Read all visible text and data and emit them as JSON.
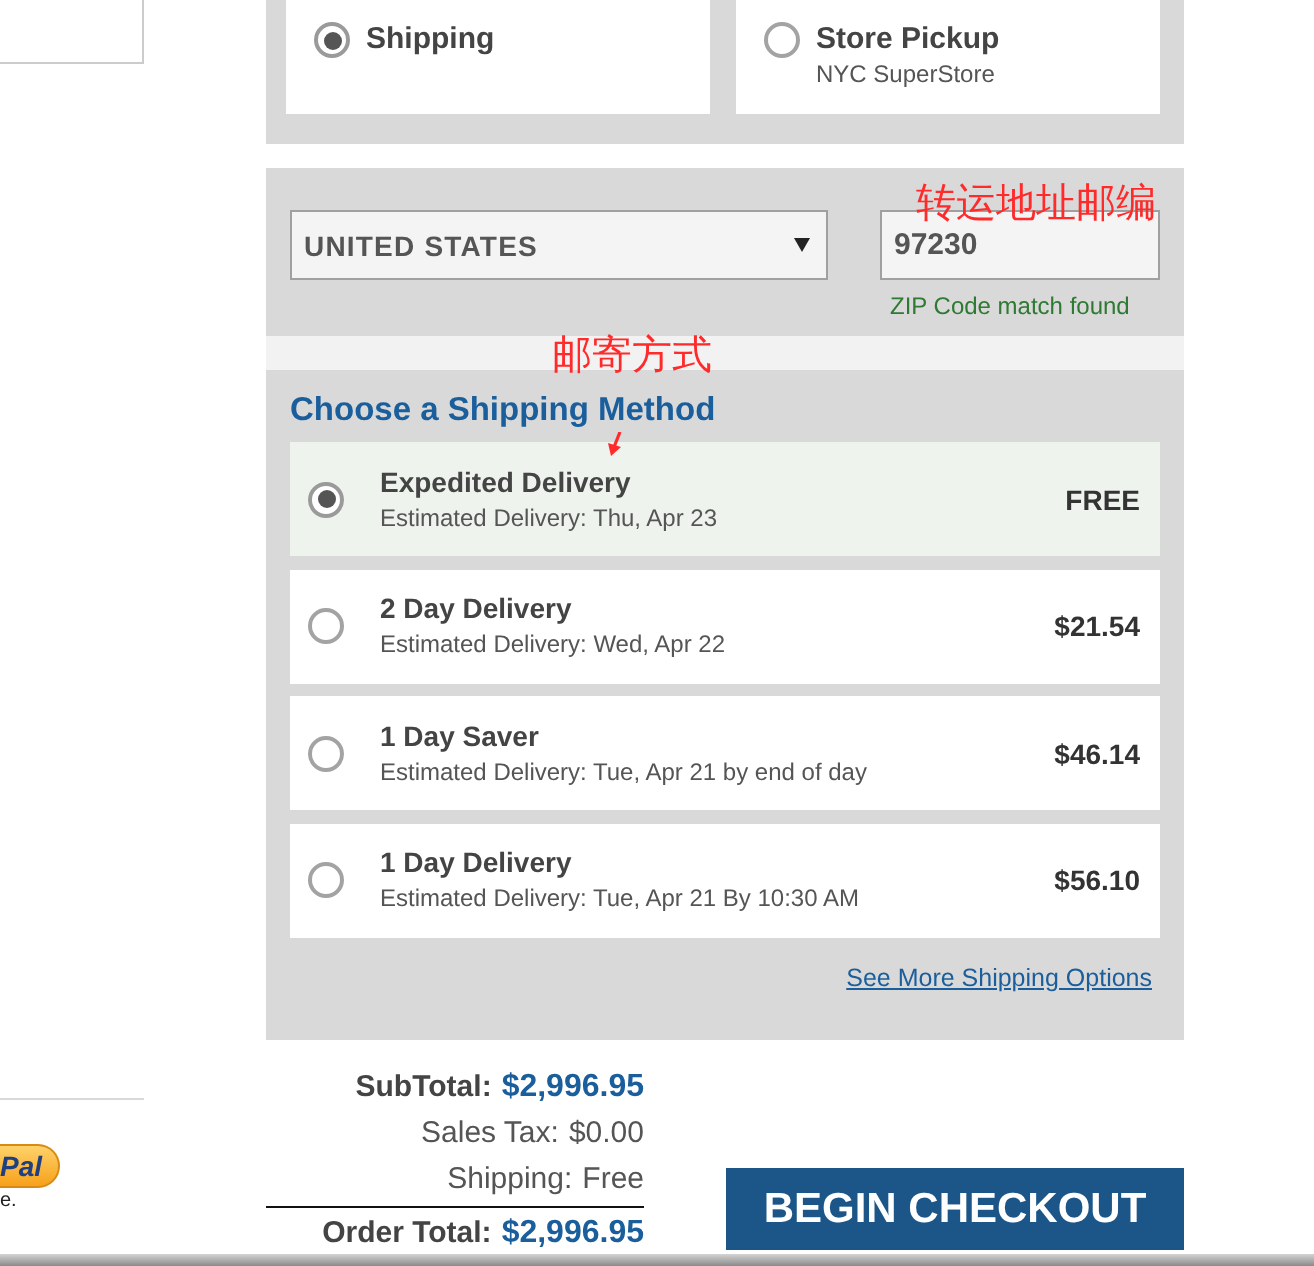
{
  "side": {
    "paypal_button": "Pal",
    "note": "e."
  },
  "delivery_options": [
    {
      "label": "Shipping",
      "selected": true
    },
    {
      "label": "Store Pickup",
      "sublabel": "NYC SuperStore",
      "selected": false
    }
  ],
  "address": {
    "country": "UNITED STATES",
    "zip": "97230",
    "zip_status": "ZIP Code match found"
  },
  "annotations": [
    {
      "kind": "text",
      "text": "转运地址邮编"
    },
    {
      "kind": "text",
      "text": "邮寄方式"
    },
    {
      "kind": "arrow"
    }
  ],
  "shipping": {
    "title": "Choose a Shipping Method",
    "methods": [
      {
        "name": "Expedited Delivery",
        "estimate": "Estimated Delivery: Thu, Apr 23",
        "price": "FREE",
        "selected": true
      },
      {
        "name": "2 Day Delivery",
        "estimate": "Estimated Delivery: Wed, Apr 22",
        "price": "$21.54",
        "selected": false
      },
      {
        "name": "1 Day Saver",
        "estimate": "Estimated Delivery: Tue, Apr 21 by end of day",
        "price": "$46.14",
        "selected": false
      },
      {
        "name": "1 Day Delivery",
        "estimate": "Estimated Delivery: Tue, Apr 21 By 10:30 AM",
        "price": "$56.10",
        "selected": false
      }
    ],
    "more_link": "See More Shipping Options"
  },
  "summary": [
    {
      "kind": "subtotal",
      "label": "SubTotal:",
      "value": "$2,996.95"
    },
    {
      "kind": "line",
      "label": "Sales Tax:",
      "value": "$0.00"
    },
    {
      "kind": "line",
      "label": "Shipping:",
      "value": "Free"
    },
    {
      "kind": "total",
      "label": "Order Total:",
      "value": "$2,996.95"
    }
  ],
  "checkout_button": "BEGIN CHECKOUT"
}
